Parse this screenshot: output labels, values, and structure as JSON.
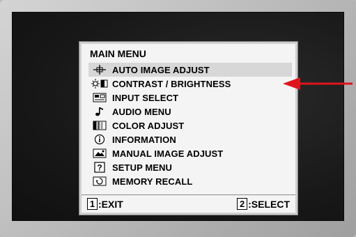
{
  "menu": {
    "title": "MAIN MENU",
    "items": [
      {
        "label": "AUTO IMAGE ADJUST",
        "icon": "crosshair-icon",
        "selected": true
      },
      {
        "label": "CONTRAST / BRIGHTNESS",
        "icon": "sun-contrast-icon"
      },
      {
        "label": "INPUT SELECT",
        "icon": "input-screens-icon"
      },
      {
        "label": "AUDIO MENU",
        "icon": "music-note-icon"
      },
      {
        "label": "COLOR ADJUST",
        "icon": "color-bars-icon"
      },
      {
        "label": "INFORMATION",
        "icon": "info-icon"
      },
      {
        "label": "MANUAL IMAGE ADJUST",
        "icon": "manual-adjust-icon"
      },
      {
        "label": "SETUP MENU",
        "icon": "question-box-icon"
      },
      {
        "label": "MEMORY RECALL",
        "icon": "memory-recall-icon"
      }
    ]
  },
  "footer": {
    "exit_key": "1",
    "exit_label": ":EXIT",
    "select_key": "2",
    "select_label": ":SELECT"
  },
  "colors": {
    "arrow": "#e0141c",
    "osd_background": "#f4f4f4",
    "selected_row": "#d7d7d7"
  }
}
